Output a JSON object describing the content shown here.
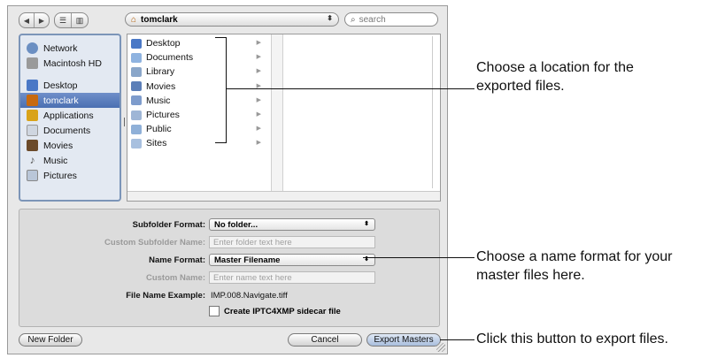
{
  "toolbar": {
    "nav_back": "◀",
    "nav_forward": "▶",
    "view_list": "☰",
    "view_columns": "▥",
    "path_icon": "home-icon",
    "path_label": "tomclark",
    "path_arrows": "⬍",
    "search_placeholder": "search"
  },
  "sidebar": {
    "devices": [
      {
        "label": "Network",
        "icon": "network-icon",
        "color": "#6b8fc2"
      },
      {
        "label": "Macintosh HD",
        "icon": "hard-drive-icon",
        "color": "#9a9a9a"
      }
    ],
    "places": [
      {
        "label": "Desktop",
        "icon": "desktop-icon",
        "color": "#4a78c6"
      },
      {
        "label": "tomclark",
        "icon": "home-icon",
        "color": "#c76a10",
        "selected": true
      },
      {
        "label": "Applications",
        "icon": "applications-icon",
        "color": "#d9a31a"
      },
      {
        "label": "Documents",
        "icon": "documents-icon",
        "color": "#cfd6e0"
      },
      {
        "label": "Movies",
        "icon": "movies-icon",
        "color": "#6b4a2a"
      },
      {
        "label": "Music",
        "icon": "music-icon",
        "color": "#555555"
      },
      {
        "label": "Pictures",
        "icon": "pictures-icon",
        "color": "#b9c6d8"
      }
    ]
  },
  "browser": {
    "items": [
      {
        "label": "Desktop",
        "icon": "desktop-folder-icon",
        "color": "#4a78c6"
      },
      {
        "label": "Documents",
        "icon": "documents-folder-icon",
        "color": "#8fb3e0"
      },
      {
        "label": "Library",
        "icon": "library-folder-icon",
        "color": "#8aa6c9"
      },
      {
        "label": "Movies",
        "icon": "movies-folder-icon",
        "color": "#5c7fb8"
      },
      {
        "label": "Music",
        "icon": "music-folder-icon",
        "color": "#7e9ccc"
      },
      {
        "label": "Pictures",
        "icon": "pictures-folder-icon",
        "color": "#9fb6d6"
      },
      {
        "label": "Public",
        "icon": "public-folder-icon",
        "color": "#8fb0d8"
      },
      {
        "label": "Sites",
        "icon": "sites-folder-icon",
        "color": "#a8c0df"
      }
    ]
  },
  "form": {
    "subfolder_format_label": "Subfolder Format:",
    "subfolder_format_value": "No folder...",
    "custom_subfolder_label": "Custom Subfolder Name:",
    "custom_subfolder_placeholder": "Enter folder text here",
    "name_format_label": "Name Format:",
    "name_format_value": "Master Filename",
    "custom_name_label": "Custom Name:",
    "custom_name_placeholder": "Enter name text here",
    "file_example_label": "File Name Example:",
    "file_example_value": "IMP.008.Navigate.tiff",
    "sidecar_label": "Create IPTC4XMP sidecar file",
    "sidecar_checked": false
  },
  "buttons": {
    "new_folder": "New Folder",
    "cancel": "Cancel",
    "export": "Export Masters"
  },
  "annotations": {
    "location_line1": "Choose a location for the",
    "location_line2": "exported files.",
    "name_line1": "Choose a name format for your",
    "name_line2": "master files here.",
    "export": "Click this button to export files."
  }
}
